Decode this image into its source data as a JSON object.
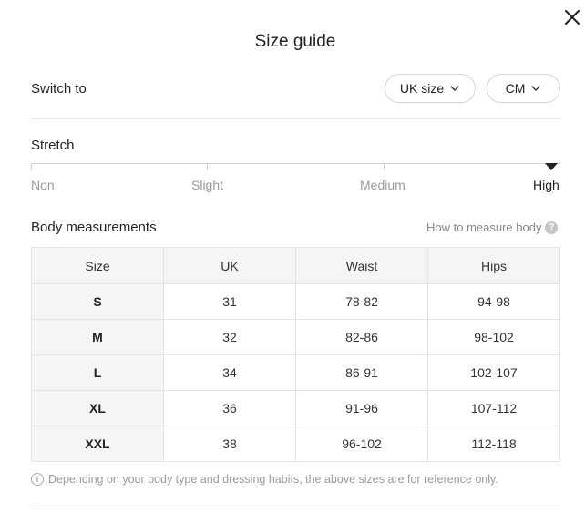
{
  "dialog": {
    "title": "Size guide"
  },
  "switch": {
    "label": "Switch to",
    "size_system": "UK size",
    "unit": "CM"
  },
  "stretch": {
    "label": "Stretch",
    "levels": [
      "Non",
      "Slight",
      "Medium",
      "High"
    ],
    "selected": "High"
  },
  "body": {
    "label": "Body measurements",
    "how_to_link": "How to measure body"
  },
  "table": {
    "headers": [
      "Size",
      "UK",
      "Waist",
      "Hips"
    ],
    "rows": [
      [
        "S",
        "31",
        "78-82",
        "94-98"
      ],
      [
        "M",
        "32",
        "82-86",
        "98-102"
      ],
      [
        "L",
        "34",
        "86-91",
        "102-107"
      ],
      [
        "XL",
        "36",
        "91-96",
        "107-112"
      ],
      [
        "XXL",
        "38",
        "96-102",
        "112-118"
      ]
    ]
  },
  "note": "Depending on your body type and dressing habits, the above sizes are for reference only.",
  "icons": {
    "close": "close-icon",
    "chevron": "chevron-down-icon",
    "help": "question-circle-icon",
    "info": "info-circle-icon"
  }
}
